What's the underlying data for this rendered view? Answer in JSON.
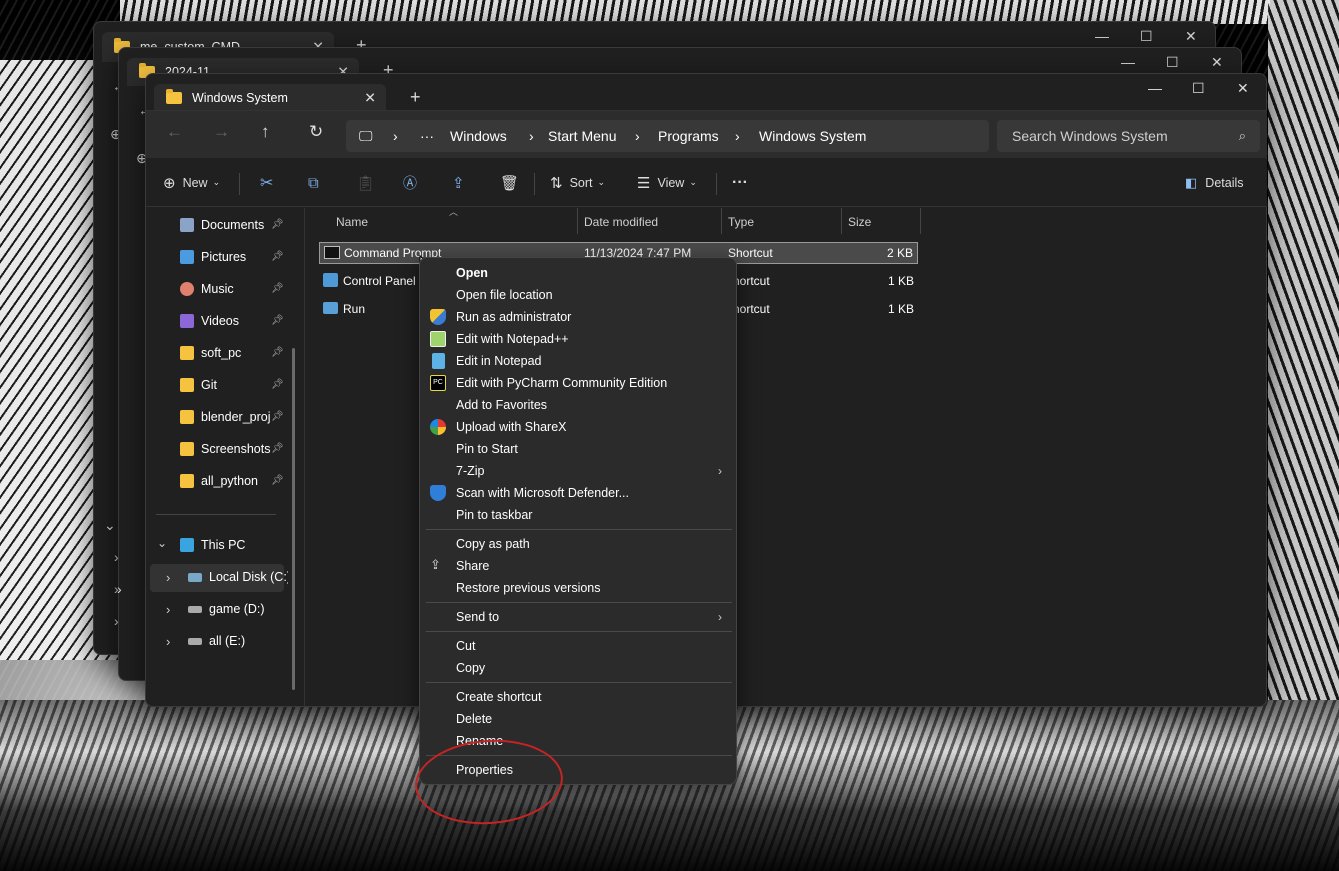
{
  "back_windows": [
    {
      "tab_title": "me_custom_CMD"
    },
    {
      "tab_title": "2024-11"
    }
  ],
  "window": {
    "tab_title": "Windows System",
    "controls": {
      "minimize": "—",
      "maximize": "☐",
      "close": "✕"
    },
    "breadcrumb": [
      "Windows",
      "Start Menu",
      "Programs",
      "Windows System"
    ],
    "search_placeholder": "Search Windows System",
    "toolbar": {
      "new": "New",
      "sort": "Sort",
      "view": "View",
      "more": "···",
      "details": "Details"
    },
    "sidebar": {
      "quick_access": [
        {
          "label": "Documents",
          "color": "#8aa3c7"
        },
        {
          "label": "Pictures",
          "color": "#4b9be0"
        },
        {
          "label": "Music",
          "color": "#e0806d"
        },
        {
          "label": "Videos",
          "color": "#8b67d8"
        },
        {
          "label": "soft_pc",
          "color": "#f6c340"
        },
        {
          "label": "Git",
          "color": "#f6c340"
        },
        {
          "label": "blender_proj",
          "color": "#f6c340"
        },
        {
          "label": "Screenshots",
          "color": "#f6c340"
        },
        {
          "label": "all_python",
          "color": "#f6c340"
        }
      ],
      "this_pc": "This PC",
      "drives": [
        {
          "label": "Local Disk (C:)"
        },
        {
          "label": "game (D:)"
        },
        {
          "label": "all (E:)"
        }
      ]
    },
    "columns": {
      "name": "Name",
      "date": "Date modified",
      "type": "Type",
      "size": "Size"
    },
    "files": [
      {
        "name": "Command Prompt",
        "date": "11/13/2024 7:47 PM",
        "type": "Shortcut",
        "size": "2 KB"
      },
      {
        "name": "Control Panel",
        "date": "",
        "type": "hortcut",
        "size": "1 KB"
      },
      {
        "name": "Run",
        "date": "",
        "type": "hortcut",
        "size": "1 KB"
      }
    ]
  },
  "context_menu": {
    "items": [
      {
        "label": "Open",
        "bold": true
      },
      {
        "label": "Open file location"
      },
      {
        "label": "Run as administrator",
        "icon": "shield-icon"
      },
      {
        "label": "Edit with Notepad++",
        "icon": "notepadpp-icon"
      },
      {
        "label": "Edit in Notepad",
        "icon": "notepad-icon"
      },
      {
        "label": "Edit with PyCharm Community Edition",
        "icon": "pycharm-icon"
      },
      {
        "label": "Add to Favorites"
      },
      {
        "label": "Upload with ShareX",
        "icon": "sharex-icon"
      },
      {
        "label": "Pin to Start"
      },
      {
        "label": "7-Zip",
        "submenu": true
      },
      {
        "label": "Scan with Microsoft Defender...",
        "icon": "defender-icon"
      },
      {
        "label": "Pin to taskbar"
      },
      {
        "label": "Copy as path"
      },
      {
        "label": "Share",
        "icon": "share-icon"
      },
      {
        "label": "Restore previous versions"
      },
      {
        "label": "Send to",
        "submenu": true
      },
      {
        "label": "Cut"
      },
      {
        "label": "Copy"
      },
      {
        "label": "Create shortcut"
      },
      {
        "label": "Delete"
      },
      {
        "label": "Rename"
      },
      {
        "label": "Properties"
      }
    ],
    "highlight_color": "#c42424"
  }
}
